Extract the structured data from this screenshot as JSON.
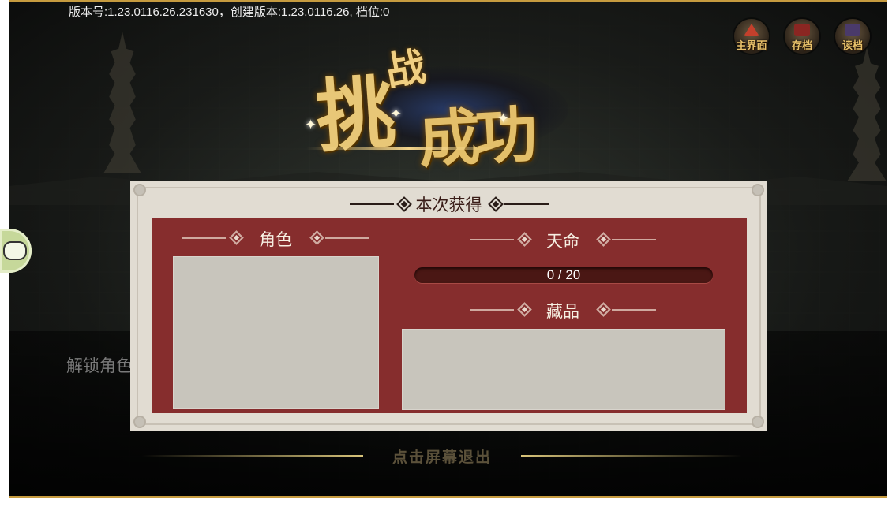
{
  "version_text": "版本号:1.23.0116.26.231630，创建版本:1.23.0116.26, 档位:0",
  "top_buttons": [
    {
      "label": "主界面",
      "icon": "pagoda-icon"
    },
    {
      "label": "存档",
      "icon": "save-icon"
    },
    {
      "label": "读档",
      "icon": "load-icon"
    }
  ],
  "title": {
    "line1": "挑",
    "line2": "战",
    "line3": "成功"
  },
  "background_text": {
    "unlock": "解锁角色"
  },
  "panel": {
    "header": "本次获得",
    "sections": {
      "role": "角色",
      "fate": "天命",
      "collection": "藏品"
    },
    "fate_progress": {
      "current": 0,
      "max": 20,
      "text": "0 / 20"
    }
  },
  "exit_hint": "点击屏幕退出",
  "colors": {
    "panel_red": "#862d2d",
    "panel_bg": "#e1dcd2",
    "gold": "#c69b3f"
  }
}
